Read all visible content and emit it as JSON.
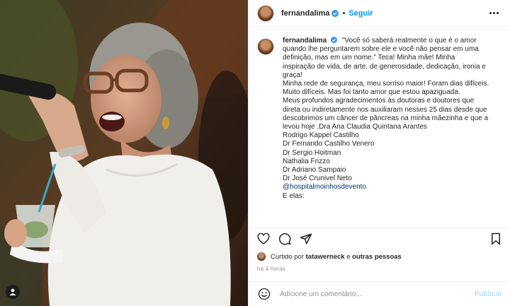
{
  "post": {
    "username": "fernandalima",
    "verified": true,
    "follow_label": "Seguir",
    "separator": "•"
  },
  "caption": {
    "username": "fernandalima",
    "lines": [
      "\"Você só saberá realmente o que é o amor",
      "quando lhe perguntarem sobre ele e você não pensar em uma",
      "definição, mas em um nome.\" Teca! Minha mãe! Minha",
      "inspiração de vida, de arte, de generosidade, dedicação, ironia e",
      "graça!",
      "Minha rede de segurança, meu sorriso maior! Foram dias difíceis.",
      "Muito difíceis. Mas foi tanto amor que estou apaziguada.",
      "Meus profundos agradecimentos às doutoras e doutores que",
      "direta ou indiretamente nos auxiliaram nesses 25 dias desde que",
      "descobrimos um câncer de pâncreas na minha mãezinha e que a",
      "levou hoje .Dra Ana Claudia Quintana Arantes",
      "Rodrigo Kappel Castilho",
      "Dr Fernando Castilho Venero",
      "Dr Sergio Hoitman",
      "Nathalia Frizzo",
      "Dr Adriano Sampaio",
      "Dr José Crunivel Neto"
    ],
    "mention": "@hospitalmoinhosdevento",
    "last_line": "E elas:"
  },
  "likes": {
    "prefix": "Curtido por",
    "user": "tatawerneck",
    "conjunction": "e",
    "others": "outras pessoas"
  },
  "time_ago": "há 4 horas",
  "comment_box": {
    "placeholder": "Adicione um comentário...",
    "publish_label": "Publicar"
  },
  "icons": {
    "verified": "verified-badge-icon",
    "more": "more-options-icon",
    "like": "heart-icon",
    "comment": "comment-bubble-icon",
    "share": "paper-plane-icon",
    "save": "bookmark-icon",
    "emoji": "smiley-icon",
    "tag": "user-tag-icon"
  },
  "colors": {
    "link_blue": "#0095f6",
    "mention": "#00376b",
    "verified": "#3897f0",
    "publish_disabled": "#b2dffc",
    "meta_gray": "#8e8e8e"
  }
}
